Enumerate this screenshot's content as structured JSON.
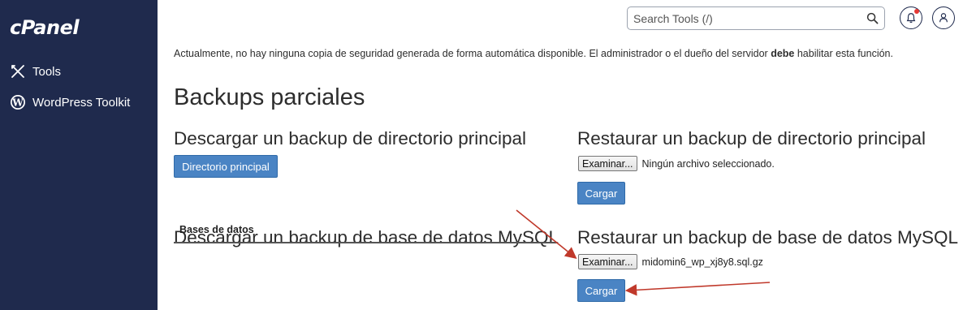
{
  "colors": {
    "sidebar": "#1f2a4d",
    "primary_button": "#4a84c4",
    "annotation_arrow": "#c0392b",
    "notification_dot": "#e53935"
  },
  "sidebar": {
    "logo": "cPanel",
    "items": [
      {
        "label": "Tools",
        "icon": "tools-icon"
      },
      {
        "label": "WordPress Toolkit",
        "icon": "wordpress-icon"
      }
    ]
  },
  "header": {
    "search_placeholder": "Search Tools (/)",
    "search_icon": "search-icon",
    "notifications_icon": "bell-icon",
    "user_icon": "user-icon"
  },
  "main": {
    "backup_notice_pre": "Actualmente, no hay ninguna copia de seguridad generada de forma automática disponible. El administrador o el dueño del servidor ",
    "backup_notice_bold": "debe",
    "backup_notice_post": " habilitar esta función.",
    "partial_title": "Backups parciales",
    "download_home": {
      "title": "Descargar un backup de directorio principal",
      "button": "Directorio principal"
    },
    "restore_home": {
      "title": "Restaurar un backup de directorio principal",
      "browse_button": "Examinar...",
      "file_status": "Ningún archivo seleccionado.",
      "upload_button": "Cargar"
    },
    "download_mysql": {
      "title": "Descargar un backup de base de datos MySQL",
      "table_header": "Bases de datos"
    },
    "restore_mysql": {
      "title": "Restaurar un backup de base de datos MySQL",
      "browse_button": "Examinar...",
      "file_status": "midomin6_wp_xj8y8.sql.gz",
      "upload_button": "Cargar"
    }
  }
}
